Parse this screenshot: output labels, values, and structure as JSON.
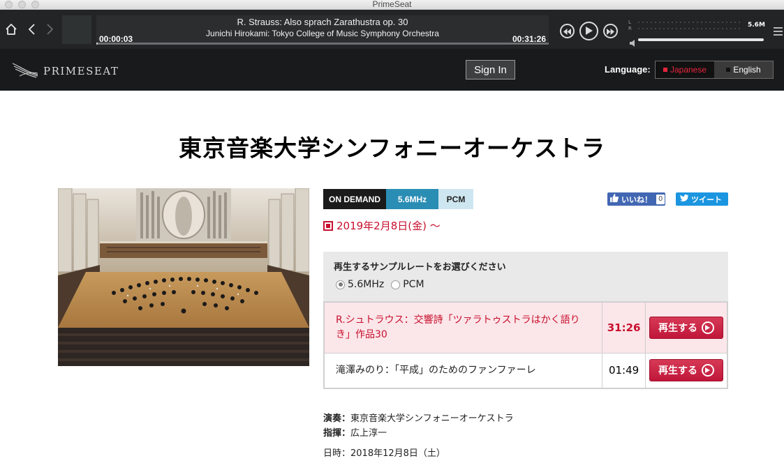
{
  "window": {
    "title": "PrimeSeat"
  },
  "player": {
    "track_title": "R. Strauss: Also sprach Zarathustra op. 30",
    "track_artist": "Junichi Hirokami: Tokyo College of Music Symphony Orchestra",
    "elapsed": "00:00:03",
    "duration": "00:31:26",
    "progress": 0.0016,
    "meter_left_label": "L",
    "meter_right_label": "R",
    "sample_rate_readout": "5.6M",
    "volume": 1.0
  },
  "header": {
    "logo_text": "PRIMESEAT",
    "signin_label": "Sign In",
    "language_label": "Language:",
    "languages": [
      {
        "label": "Japanese",
        "selected": true
      },
      {
        "label": "English",
        "selected": false
      }
    ]
  },
  "page": {
    "title": "東京音楽大学シンフォニーオーケストラ",
    "tags": {
      "on_demand": "ON DEMAND",
      "mhz": "5.6MHz",
      "pcm": "PCM"
    },
    "social": {
      "like_label": "いいね！",
      "like_count": "0",
      "tweet_label": "ツイート"
    },
    "date": "2019年2月8日(金) 〜",
    "sample_rate_question": "再生するサンプルレートをお選びください",
    "rate_options": [
      {
        "label": "5.6MHz",
        "selected": true
      },
      {
        "label": "PCM",
        "selected": false
      }
    ],
    "tracks": [
      {
        "name": "R.シュトラウス：交響詩「ツァラトゥストラはかく語りき」作品30",
        "duration": "31:26",
        "button": "再生する",
        "selected": true
      },
      {
        "name": "滝澤みのり：「平成」のためのファンファーレ",
        "duration": "01:49",
        "button": "再生する",
        "selected": false
      }
    ],
    "credits": {
      "performer_label": "演奏：",
      "performer": "東京音楽大学シンフォニーオーケストラ",
      "conductor_label": "指揮：",
      "conductor": "広上淳一",
      "date_label": "日時：",
      "date": "2018年12月8日（土）"
    }
  },
  "colors": {
    "accent": "#c8102e",
    "header_bg": "#191a1b",
    "player_bg": "#222425",
    "mhz_tag": "#2a8db4",
    "pcm_tag": "#cde6ef"
  },
  "icons": [
    "home-icon",
    "back-icon",
    "forward-icon",
    "rewind-icon",
    "play-icon",
    "fast-forward-icon",
    "volume-icon",
    "menu-icon",
    "thumbs-up-icon",
    "twitter-bird-icon",
    "play-circle-icon"
  ]
}
